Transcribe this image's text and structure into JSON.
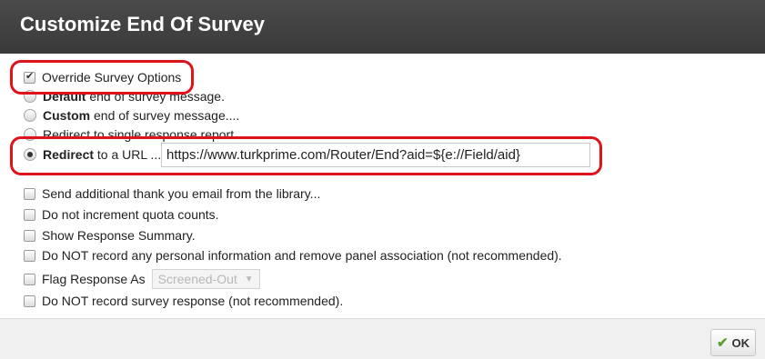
{
  "dialog": {
    "title": "Customize End Of Survey",
    "ok_label": "OK"
  },
  "options": {
    "override_label": "Override Survey Options",
    "override_checked": true,
    "default_bold": "Default",
    "default_rest": " end of survey message.",
    "custom_bold": "Custom",
    "custom_rest": " end of survey message....",
    "redirect_report": "Redirect to single response report",
    "redirect_bold": "Redirect",
    "redirect_rest": " to a URL ...",
    "redirect_url": "https://www.turkprime.com/Router/End?aid=${e://Field/aid}",
    "selected": "redirect_url"
  },
  "extras": {
    "thank_you_email": "Send additional thank you email from the library...",
    "no_quota": "Do not increment quota counts.",
    "show_summary": "Show Response Summary.",
    "no_personal": "Do NOT record any personal information and remove panel association (not recommended).",
    "flag_response": "Flag Response As",
    "flag_value": "Screened-Out",
    "no_record": "Do NOT record survey response (not recommended)."
  },
  "colors": {
    "title_bar": "#3a3a3a",
    "highlight": "#e0121b",
    "ok_check": "#5aa02c"
  },
  "icons": {
    "ok": "check-icon",
    "dropdown": "chevron-down-icon"
  }
}
